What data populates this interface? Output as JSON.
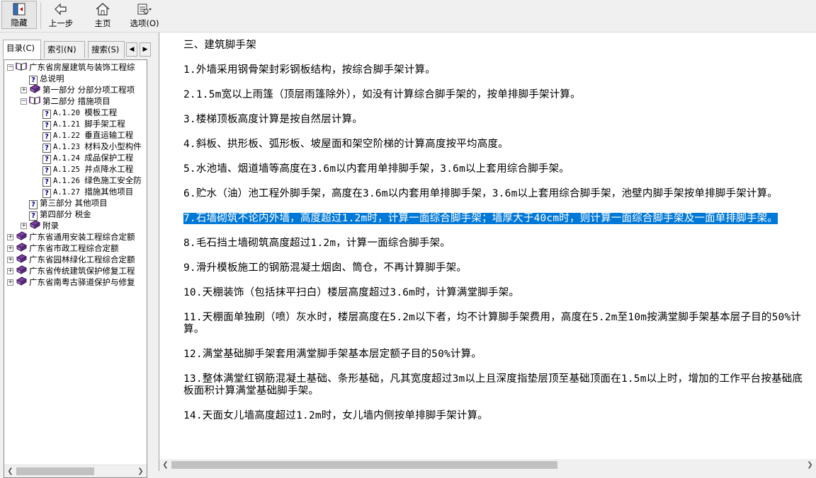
{
  "toolbar": {
    "hide": "隐藏",
    "back": "上一步",
    "home": "主页",
    "options": "选项(O)"
  },
  "nav": {
    "tabs": [
      "目录(C)",
      "索引(N)",
      "搜索(S)"
    ],
    "tree": [
      {
        "text": "广东省房屋建筑与装饰工程综",
        "type": "book-open",
        "exp": "−"
      },
      {
        "text": "总说明",
        "type": "page"
      },
      {
        "text": "第一部分 分部分项工程项",
        "type": "book",
        "exp": "+"
      },
      {
        "text": "第二部分 措施项目",
        "type": "book-open",
        "exp": "−"
      },
      {
        "num": "A.1.20",
        "text": "模板工程",
        "type": "page"
      },
      {
        "num": "A.1.21",
        "text": "脚手架工程",
        "type": "page"
      },
      {
        "num": "A.1.22",
        "text": "垂直运输工程",
        "type": "page"
      },
      {
        "num": "A.1.23",
        "text": "材料及小型构件",
        "type": "page"
      },
      {
        "num": "A.1.24",
        "text": "成品保护工程",
        "type": "page"
      },
      {
        "num": "A.1.25",
        "text": "井点降水工程",
        "type": "page"
      },
      {
        "num": "A.1.26",
        "text": "绿色施工安全防",
        "type": "page"
      },
      {
        "num": "A.1.27",
        "text": "措施其他项目",
        "type": "page"
      },
      {
        "text": "第三部分 其他项目",
        "type": "page"
      },
      {
        "text": "第四部分 税金",
        "type": "page"
      },
      {
        "text": "附录",
        "type": "book",
        "exp": "+"
      },
      {
        "text": "广东省通用安装工程综合定额",
        "type": "book",
        "exp": "+"
      },
      {
        "text": "广东省市政工程综合定额",
        "type": "book",
        "exp": "+"
      },
      {
        "text": "广东省园林绿化工程综合定额",
        "type": "book",
        "exp": "+"
      },
      {
        "text": "广东省传统建筑保护修复工程",
        "type": "book",
        "exp": "+"
      },
      {
        "text": "广东省南粤古驿道保护与修复",
        "type": "book",
        "exp": "+"
      }
    ]
  },
  "content": {
    "paragraphs": [
      "三、建筑脚手架",
      "1.外墙采用钢骨架封彩钢板结构，按综合脚手架计算。",
      "2.1.5m宽以上雨篷（顶层雨篷除外），如没有计算综合脚手架的，按单排脚手架计算。",
      "3.楼梯顶板高度计算是按自然层计算。",
      "4.斜板、拱形板、弧形板、坡屋面和架空阶梯的计算高度按平均高度。",
      "5.水池墙、烟道墙等高度在3.6m以内套用单排脚手架，3.6m以上套用综合脚手架。",
      "6.贮水（油）池工程外脚手架，高度在3.6m以内套用单排脚手架，3.6m以上套用综合脚手架，池壁内脚手架按单排脚手架计算。",
      "7.石墙砌筑不论内外墙，高度超过1.2m时，计算一面综合脚手架；墙厚大于40cm时，则计算一面综合脚手架及一面单排脚手架。",
      "8.毛石挡土墙砌筑高度超过1.2m，计算一面综合脚手架。",
      "9.滑升模板施工的钢筋混凝土烟囱、筒仓，不再计算脚手架。",
      "10.天棚装饰（包括抹平扫白）楼层高度超过3.6m时，计算满堂脚手架。",
      "11.天棚面单独刷（喷）灰水时，楼层高度在5.2m以下者，均不计算脚手架费用，高度在5.2m至10m按满堂脚手架基本层子目的50%计算。",
      "12.满堂基础脚手架套用满堂脚手架基本层定额子目的50%计算。",
      "13.整体满堂红钢筋混凝土基础、条形基础，凡其宽度超过3m以上且深度指垫层顶至基础顶面在1.5m以上时，增加的工作平台按基础底板面积计算满堂基础脚手架。",
      "14.天面女儿墙高度超过1.2m时，女儿墙内侧按单排脚手架计算。"
    ],
    "selected_index": 7
  },
  "colors": {
    "selection": "#0078d7",
    "tree_book": "#7b3f9e"
  }
}
